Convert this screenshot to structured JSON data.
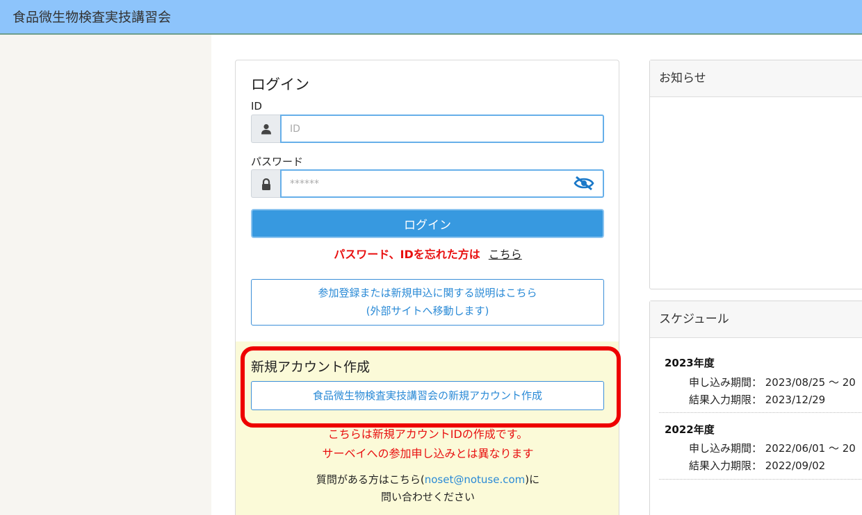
{
  "header": {
    "title": "食品微生物検査実技講習会"
  },
  "login": {
    "title": "ログイン",
    "id_label": "ID",
    "id_placeholder": "ID",
    "password_label": "パスワード",
    "password_placeholder": "******",
    "login_button": "ログイン",
    "forgot_text": "パスワード、IDを忘れた方は",
    "forgot_link": "こちら",
    "info_line1": "参加登録または新規申込に関する説明はこちら",
    "info_line2": "(外部サイトへ移動します)"
  },
  "new_account": {
    "title": "新規アカウント作成",
    "button": "食品微生物検査実技講習会の新規アカウント作成",
    "note1": "こちらは新規アカウントIDの作成です。",
    "note2": "サーベイへの参加申し込みとは異なります",
    "contact_prefix": "質問がある方はこちら(",
    "contact_email": "noset@notuse.com",
    "contact_suffix": ")に",
    "contact_line2": "問い合わせください"
  },
  "news": {
    "title": "お知らせ"
  },
  "schedule": {
    "title": "スケジュール",
    "years": [
      {
        "year": "2023年度",
        "apply": "申し込み期間： 2023/08/25 ～ 20",
        "deadline": "結果入力期限： 2023/12/29"
      },
      {
        "year": "2022年度",
        "apply": "申し込み期間： 2022/06/01 ～ 20",
        "deadline": "結果入力期限： 2022/09/02"
      }
    ]
  },
  "colors": {
    "header_bg": "#8dc4fb",
    "primary": "#3799e0",
    "alert": "#e81010",
    "highlight": "#ee0000"
  }
}
